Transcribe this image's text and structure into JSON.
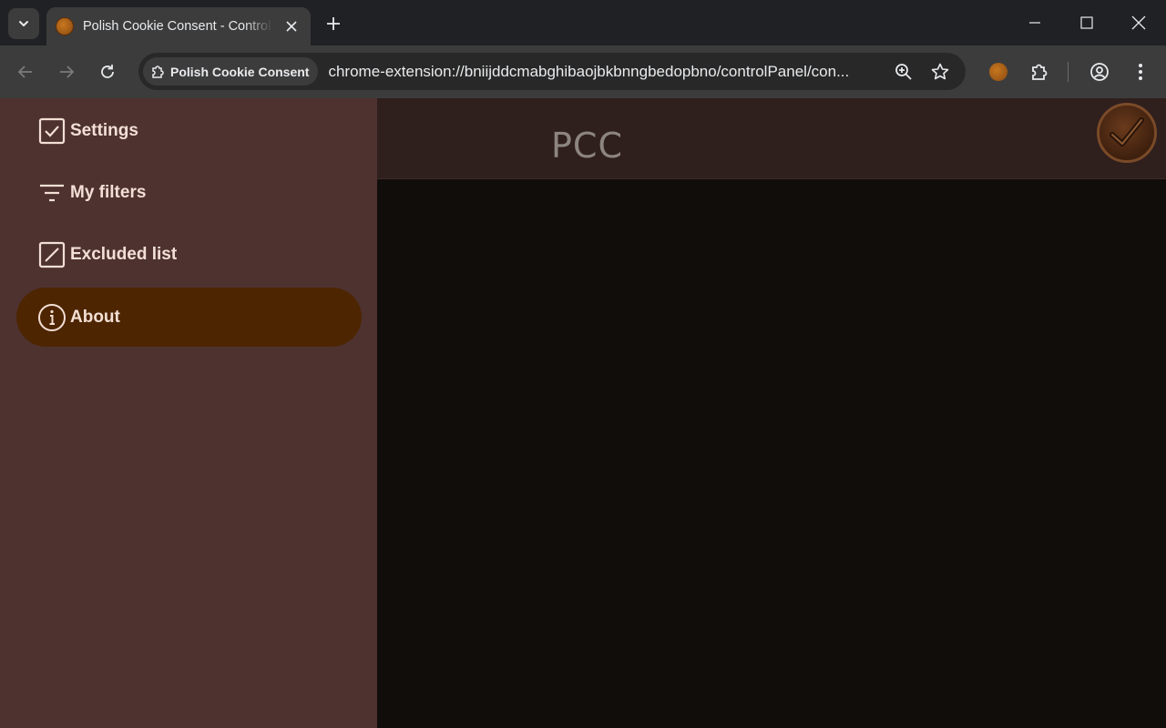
{
  "browser": {
    "tab_title": "Polish Cookie Consent - Control Panel",
    "site_chip": "Polish Cookie Consent",
    "url": "chrome-extension://bniijddcmabghibaojbkbnngbedopbno/controlPanel/con..."
  },
  "sidebar": {
    "items": [
      {
        "label": "Settings",
        "icon": "checkbox-icon",
        "active": false
      },
      {
        "label": "My filters",
        "icon": "filter-icon",
        "active": false
      },
      {
        "label": "Excluded list",
        "icon": "edit-box-icon",
        "active": false
      },
      {
        "label": "About",
        "icon": "info-icon",
        "active": true
      }
    ]
  },
  "header": {
    "title": "PCC"
  },
  "colors": {
    "sidebar_bg": "#4e3230",
    "active_item_bg": "#4d2500",
    "content_bg": "#110d0b",
    "header_bg": "#2f1f1d"
  }
}
